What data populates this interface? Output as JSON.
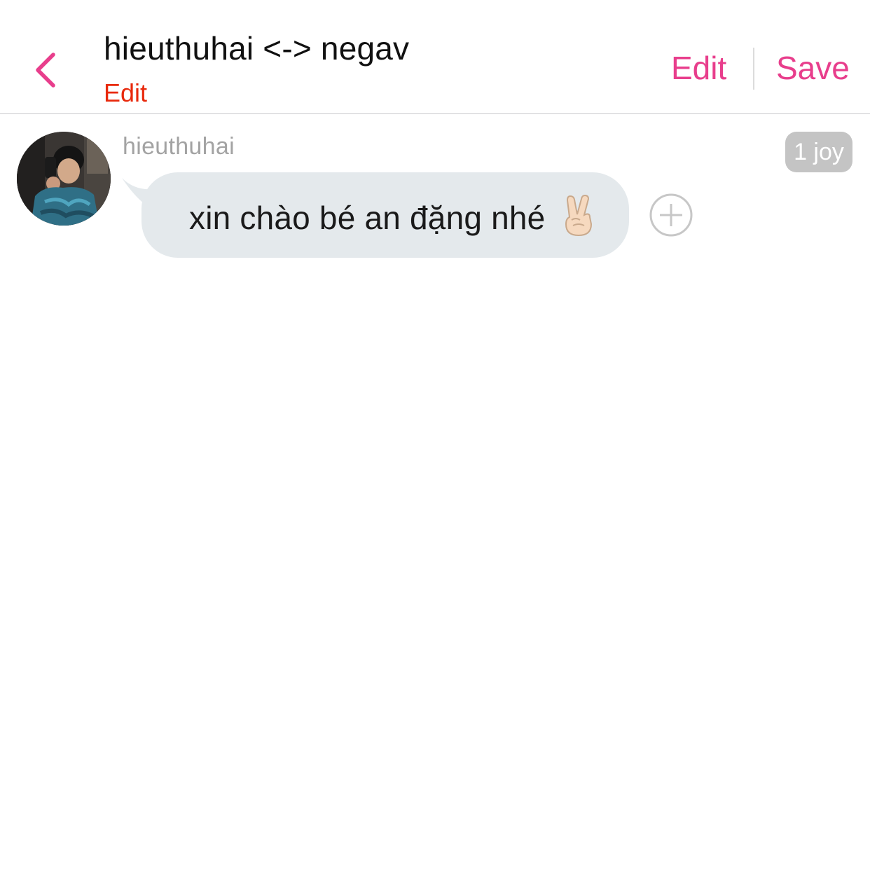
{
  "header": {
    "title": "hieuthuhai <-> negav",
    "subtitle_edit": "Edit",
    "edit_label": "Edit",
    "save_label": "Save",
    "accent_color": "#e83e8c",
    "subtitle_color": "#e8290c",
    "back_icon": "chevron-left-icon"
  },
  "message": {
    "sender": "hieuthuhai",
    "time": "1 joy",
    "text": "xin chào bé an đặng nhé",
    "emoji": "victory-hand-icon",
    "bubble_color": "#e4e9ec",
    "react_icon": "plus-circle-icon"
  }
}
